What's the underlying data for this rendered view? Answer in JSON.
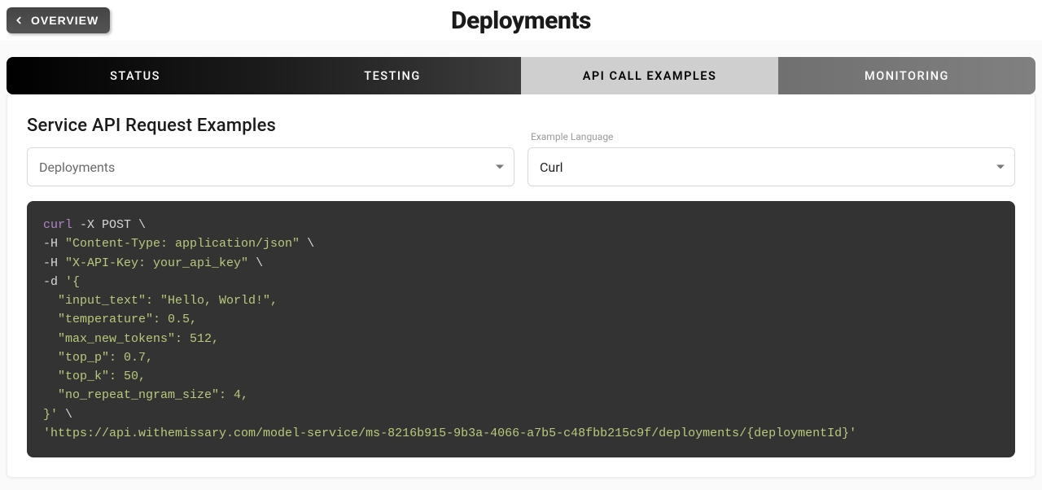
{
  "header": {
    "back_label": "OVERVIEW",
    "title": "Deployments"
  },
  "tabs": {
    "status": "STATUS",
    "testing": "TESTING",
    "apicall": "API CALL EXAMPLES",
    "monitoring": "MONITORING",
    "active": "apicall"
  },
  "section": {
    "title": "Service API Request Examples",
    "select_service": "Deployments",
    "lang_label": "Example Language",
    "select_lang": "Curl"
  },
  "code": {
    "tokens": [
      {
        "cls": "tok-cmd",
        "t": "curl"
      },
      {
        "cls": "tok-flag",
        "t": " -X POST "
      },
      {
        "cls": "tok-bs",
        "t": "\\"
      },
      {
        "nl": true
      },
      {
        "cls": "tok-flag",
        "t": "-H "
      },
      {
        "cls": "tok-str",
        "t": "\"Content-Type: application/json\""
      },
      {
        "cls": "tok-flag",
        "t": " "
      },
      {
        "cls": "tok-bs",
        "t": "\\"
      },
      {
        "nl": true
      },
      {
        "cls": "tok-flag",
        "t": "-H "
      },
      {
        "cls": "tok-str",
        "t": "\"X-API-Key: your_api_key\""
      },
      {
        "cls": "tok-flag",
        "t": " "
      },
      {
        "cls": "tok-bs",
        "t": "\\"
      },
      {
        "nl": true
      },
      {
        "cls": "tok-flag",
        "t": "-d "
      },
      {
        "cls": "tok-str",
        "t": "'{"
      },
      {
        "nl": true
      },
      {
        "cls": "tok-str",
        "t": "  \"input_text\": \"Hello, World!\","
      },
      {
        "nl": true
      },
      {
        "cls": "tok-str",
        "t": "  \"temperature\": 0.5,"
      },
      {
        "nl": true
      },
      {
        "cls": "tok-str",
        "t": "  \"max_new_tokens\": 512,"
      },
      {
        "nl": true
      },
      {
        "cls": "tok-str",
        "t": "  \"top_p\": 0.7,"
      },
      {
        "nl": true
      },
      {
        "cls": "tok-str",
        "t": "  \"top_k\": 50,"
      },
      {
        "nl": true
      },
      {
        "cls": "tok-str",
        "t": "  \"no_repeat_ngram_size\": 4,"
      },
      {
        "nl": true
      },
      {
        "cls": "tok-str",
        "t": "}'"
      },
      {
        "cls": "tok-flag",
        "t": " "
      },
      {
        "cls": "tok-bs",
        "t": "\\"
      },
      {
        "nl": true
      },
      {
        "cls": "tok-str",
        "t": "'https://api.withemissary.com/model-service/ms-8216b915-9b3a-4066-a7b5-c48fbb215c9f/deployments/{deploymentId}'"
      }
    ]
  }
}
